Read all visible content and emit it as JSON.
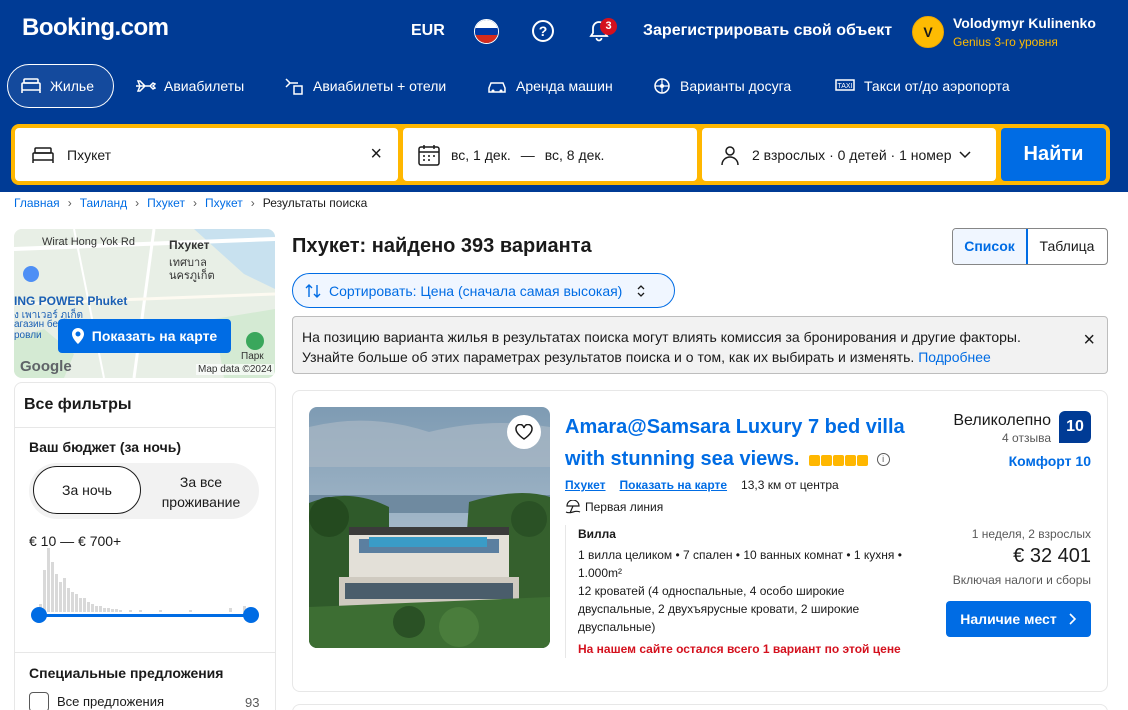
{
  "header": {
    "logo": "Booking.com",
    "currency": "EUR",
    "help": "?",
    "notifications_count": "3",
    "register_link": "Зарегистрировать свой объект",
    "user": {
      "initial": "V",
      "name": "Volodymyr Kulinenko",
      "level": "Genius 3-го уровня"
    }
  },
  "nav": [
    {
      "label": "Жилье",
      "icon": "bed-icon"
    },
    {
      "label": "Авиабилеты",
      "icon": "plane-icon"
    },
    {
      "label": "Авиабилеты + отели",
      "icon": "plane-hotel-icon"
    },
    {
      "label": "Аренда машин",
      "icon": "car-icon"
    },
    {
      "label": "Варианты досуга",
      "icon": "attractions-icon"
    },
    {
      "label": "Такси от/до аэропорта",
      "icon": "taxi-icon"
    }
  ],
  "search": {
    "destination": "Пхукет",
    "dates_from": "вс, 1 дек.",
    "dates_sep": "—",
    "dates_to": "вс, 8 дек.",
    "guests": "2 взрослых · 0 детей · 1 номер",
    "button": "Найти"
  },
  "breadcrumbs": [
    "Главная",
    "Таиланд",
    "Пхукет",
    "Пхукет"
  ],
  "breadcrumb_current": "Результаты поиска",
  "map": {
    "button": "Показать на карте",
    "labels": {
      "road": "Wirat Hong Yok Rd",
      "city": "Пхукет",
      "city_th1": "เทศบาล",
      "city_th2": "นครภูเก็ต",
      "store": "ING POWER Phuket",
      "store_th": "ง เพาเวอร์ ภูเก็ต",
      "store2": "агазин бе",
      "store3": "ровли",
      "park": "Парк"
    },
    "google": "Google",
    "copyright": "Map data ©2024"
  },
  "filters": {
    "title": "Все фильтры",
    "budget_title": "Ваш бюджет (за ночь)",
    "toggle": [
      "За ночь",
      "За все проживание"
    ],
    "range": "€ 10 — € 700+",
    "special_title": "Специальные предложения",
    "special_items": [
      {
        "label": "Все предложения",
        "count": "93"
      }
    ]
  },
  "results": {
    "title": "Пхукет: найдено 393 варианта",
    "view": [
      "Список",
      "Таблица"
    ],
    "sort": "Сортировать: Цена (сначала самая высокая)",
    "notice": "На позицию варианта жилья в результатах поиска могут влиять комиссия за бронирования и другие факторы. Узнайте больше об этих параметрах результатов поиска и о том, как их выбирать и изменять.",
    "notice_link": "Подробнее"
  },
  "property": {
    "title": "Amara@Samsara Luxury 7 bed villa with stunning sea views.",
    "stars": 5,
    "location": "Пхукет",
    "map_link": "Показать на карте",
    "distance": "13,3 км от центра",
    "beach": "Первая линия",
    "unit_name": "Вилла",
    "unit_desc": "1 вилла целиком • 7 спален • 10 ванных комнат • 1 кухня • 1.000m²",
    "beds": "12 кроватей (4 односпальные, 4 особо широкие двуспальные, 2 двухъярусные кровати, 2 широкие двуспальные)",
    "warning": "На нашем сайте остался всего 1 вариант по этой цене",
    "score_word": "Великолепно",
    "reviews": "4 отзыва",
    "score": "10",
    "comfort": "Комфорт 10",
    "stay": "1 неделя, 2 взрослых",
    "price": "€ 32 401",
    "taxes": "Включая налоги и сборы",
    "cta": "Наличие мест"
  },
  "colors": {
    "brand": "#003b95",
    "accent": "#006ce4",
    "search_border": "#ffb700",
    "warning": "#d4111e"
  }
}
